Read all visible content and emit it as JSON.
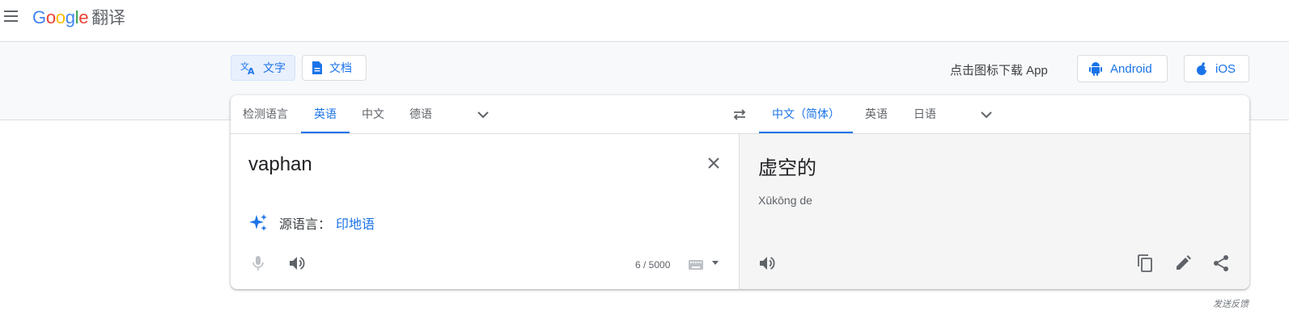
{
  "header": {
    "logo_text": "Google",
    "product_name": "翻译"
  },
  "modes": [
    {
      "label": "文字",
      "icon": "translate-icon",
      "active": true
    },
    {
      "label": "文档",
      "icon": "document-icon",
      "active": false
    }
  ],
  "download": {
    "prompt": "点击图标下载 App",
    "android_label": "Android",
    "ios_label": "iOS"
  },
  "source_languages": [
    {
      "label": "检测语言",
      "active": false
    },
    {
      "label": "英语",
      "active": true
    },
    {
      "label": "中文",
      "active": false
    },
    {
      "label": "德语",
      "active": false
    }
  ],
  "target_languages": [
    {
      "label": "中文（简体）",
      "active": true
    },
    {
      "label": "英语",
      "active": false
    },
    {
      "label": "日语",
      "active": false
    }
  ],
  "source": {
    "text": "vaphan",
    "detected_label": "源语言：",
    "detected_language": "印地语",
    "char_count": "6 / 5000"
  },
  "target": {
    "text": "虚空的",
    "romanization": "Xūkōng de"
  },
  "footer": {
    "feedback": "发送反馈"
  },
  "colors": {
    "accent": "#1a73e8",
    "target_bg": "#f5f5f5",
    "band_bg": "#f8f9fa"
  }
}
